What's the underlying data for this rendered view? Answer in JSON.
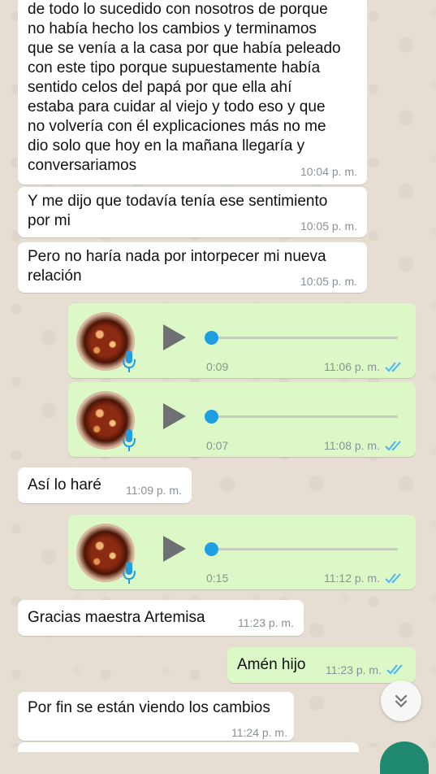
{
  "messages": [
    {
      "text": "de todo lo sucedido con nosotros de porque\nno había hecho los cambios y terminamos\nque se venía a la casa por que había peleado\ncon este tipo porque supuestamente había\nsentido celos del papá por que ella ahí\nestaba para cuidar al viejo y todo eso y que\nno volvería con él explicaciones más no me\ndio solo que hoy en la mañana llegaría y\nconversariamos",
      "time": "10:04 p. m."
    },
    {
      "text": "Y me dijo que todavía tenía ese sentimiento\npor mi",
      "time": "10:05 p. m."
    },
    {
      "text": "Pero no haría nada por intorpecer mi nueva\nrelación",
      "time": "10:05 p. m."
    },
    {
      "text": "Así lo haré",
      "time": "11:09 p. m."
    },
    {
      "text": "Gracias maestra Artemisa",
      "time": "11:23 p. m."
    },
    {
      "text": "Amén hijo",
      "time": "11:23 p. m."
    },
    {
      "text": "Por fin se están viendo los cambios",
      "time": "11:24 p. m."
    }
  ],
  "voice_notes": [
    {
      "duration": "0:09",
      "time": "11:06 p. m.",
      "progress": 0
    },
    {
      "duration": "0:07",
      "time": "11:08 p. m.",
      "progress": 0
    },
    {
      "duration": "0:15",
      "time": "11:12 p. m.",
      "progress": 0
    }
  ],
  "icons": {
    "read_receipt": "double-check-icon",
    "microphone": "mic-icon",
    "play": "play-icon",
    "scroll_down": "double-chevron-down-icon"
  },
  "colors": {
    "incoming_bubble": "#ffffff",
    "outgoing_bubble": "#dcf8c6",
    "read_ticks": "#4fb3f6",
    "progress_knob": "#1f9ee3",
    "chat_background": "#e6ded3"
  }
}
